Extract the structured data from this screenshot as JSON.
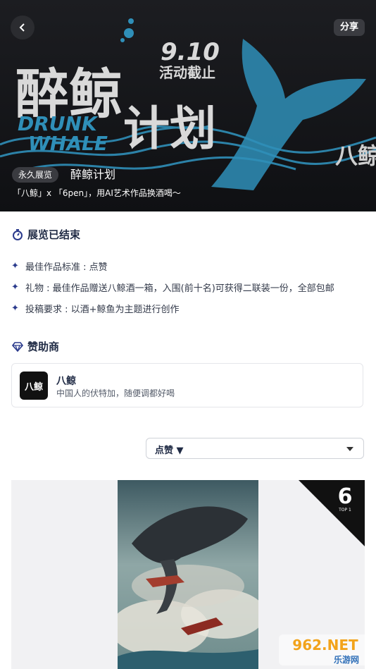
{
  "header": {
    "share_label": "分享",
    "banner_title_cn": "醉鲸",
    "banner_title_cn2": "计划",
    "banner_title_en1": "DRUNK",
    "banner_title_en2": "WHALE",
    "banner_date": "9.10",
    "banner_deadline": "活动截止",
    "banner_logo_text": "八鲸",
    "tag_label": "永久展览",
    "title": "醉鲸计划",
    "subtitle": "「八鲸」x 「6pen」，用AI艺术作品换酒喝～"
  },
  "status": {
    "title": "展览已结束"
  },
  "rules": [
    "最佳作品标准 : 点赞",
    "礼物 : 最佳作品赠送八鲸酒一箱，入围(前十名)可获得二联装一份，全部包邮",
    "投稿要求 : 以酒+鲸鱼为主题进行创作"
  ],
  "sponsor": {
    "section_title": "赞助商",
    "name": "八鲸",
    "description": "中国人的伏特加，随便调都好喝",
    "logo_text": "八鲸"
  },
  "sort": {
    "selected": "点赞 ▼"
  },
  "gallery": {
    "badge_number": "6",
    "badge_label": "TOP 1"
  },
  "watermark": {
    "site": "962.NET",
    "site_cn": "乐游网"
  },
  "colors": {
    "accent": "#2a3a8c",
    "whale_blue": "#2f8fb8",
    "hero_bg": "#141518"
  }
}
